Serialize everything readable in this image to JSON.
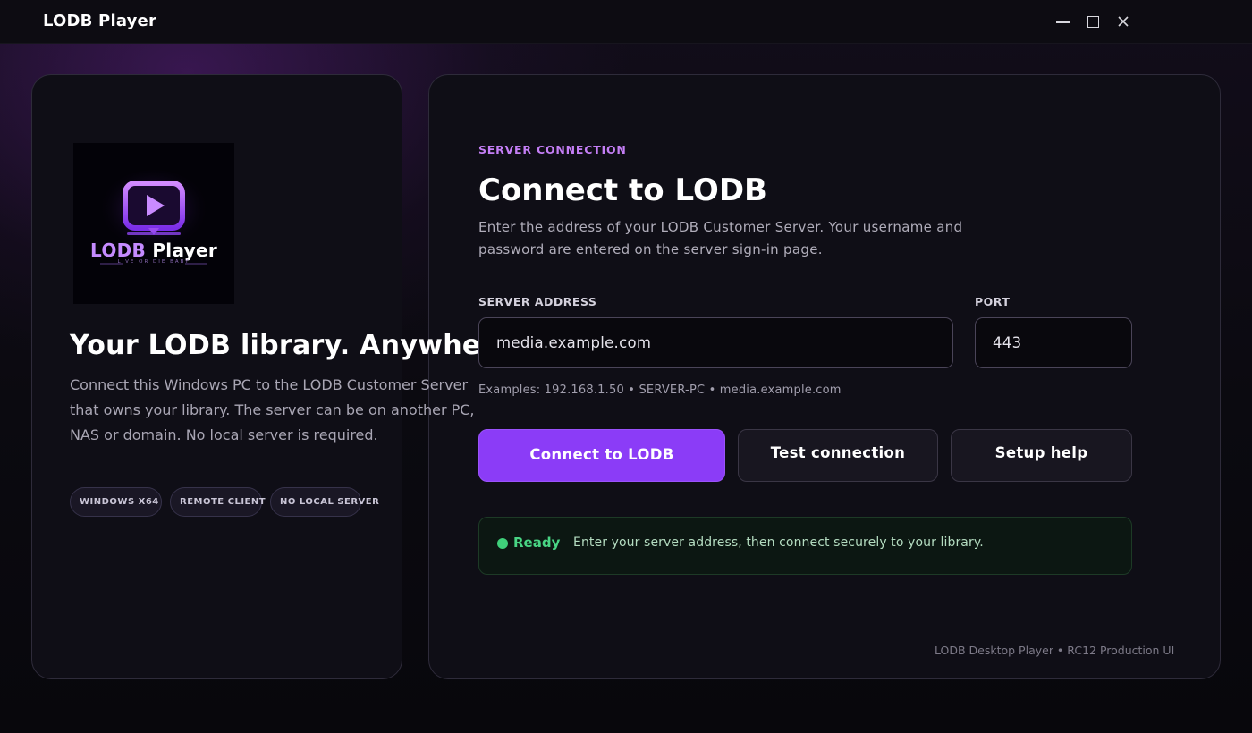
{
  "window": {
    "title": "LODB Player"
  },
  "brand": {
    "logo_text_a": "LODB",
    "logo_text_b": " Player",
    "logo_tagline": "LIVE OR DIE BABY",
    "accent": "#8b3cf7",
    "accent_light": "#c47ef5",
    "success": "#49d584"
  },
  "left_panel": {
    "title": "Your LODB library. Anywhere.",
    "description": "Connect this Windows PC to the LODB Customer Server that owns your library. The server can be on another PC, NAS or domain. No local server is required.",
    "chips": [
      "WINDOWS X64",
      "REMOTE CLIENT",
      "NO LOCAL SERVER"
    ]
  },
  "connect": {
    "eyebrow": "SERVER CONNECTION",
    "title": "Connect to LODB",
    "description": "Enter the address of your LODB Customer Server. Your username and password are entered on the server sign-in page.",
    "server_label": "SERVER ADDRESS",
    "server_value": "media.example.com",
    "port_label": "PORT",
    "port_value": "443",
    "examples": "Examples: 192.168.1.50  •  SERVER-PC  •  media.example.com",
    "connect_button": "Connect to LODB",
    "test_button": "Test connection",
    "help_button": "Setup help"
  },
  "status": {
    "label": "Ready",
    "message": "Enter your server address, then connect securely to your library."
  },
  "footer": {
    "text": "LODB Desktop Player • RC12 Production UI"
  }
}
